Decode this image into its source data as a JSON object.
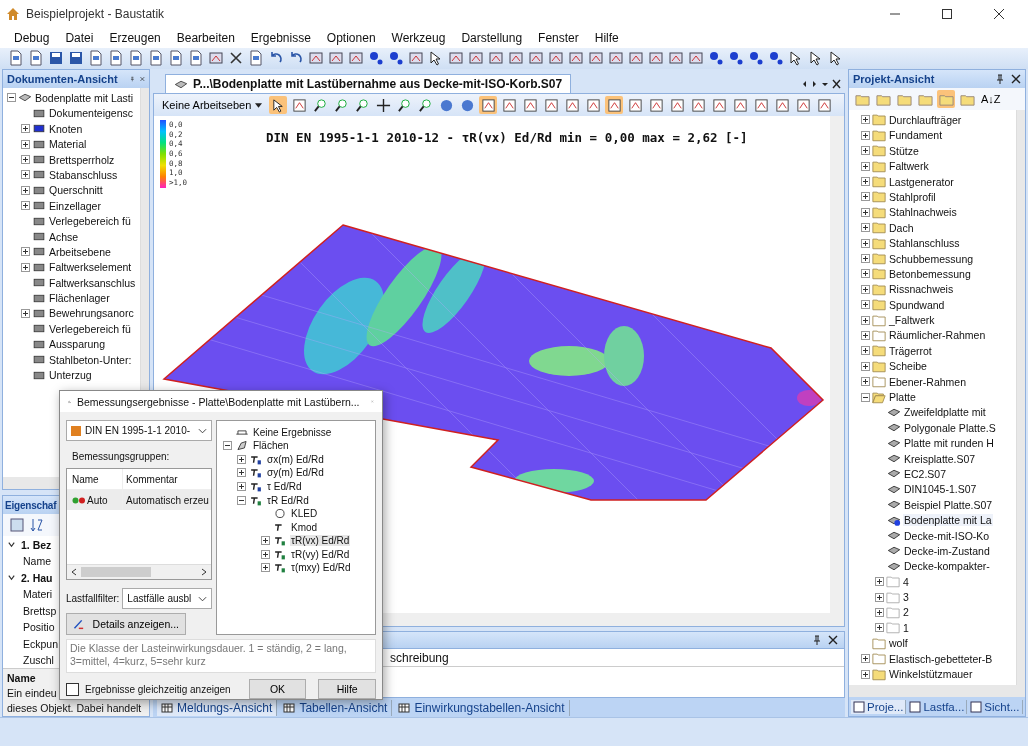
{
  "window": {
    "title": "Beispielprojekt - Baustatik"
  },
  "menu": [
    "Debug",
    "Datei",
    "Erzeugen",
    "Bearbeiten",
    "Ergebnisse",
    "Optionen",
    "Werkzeug",
    "Darstellung",
    "Fenster",
    "Hilfe"
  ],
  "documents_panel": {
    "title": "Dokumenten-Ansicht",
    "root": "Bodenplatte mit Lasti",
    "items": [
      {
        "label": "Dokumenteigensc",
        "kind": "leaf"
      },
      {
        "label": "Knoten",
        "kind": "group"
      },
      {
        "label": "Material",
        "kind": "group"
      },
      {
        "label": "Brettsperrholz",
        "kind": "group"
      },
      {
        "label": "Stabanschluss",
        "kind": "group"
      },
      {
        "label": "Querschnitt",
        "kind": "group"
      },
      {
        "label": "Einzellager",
        "kind": "group"
      },
      {
        "label": "Verlegebereich fü",
        "kind": "leaf"
      },
      {
        "label": "Achse",
        "kind": "leaf"
      },
      {
        "label": "Arbeitsebene",
        "kind": "group"
      },
      {
        "label": "Faltwerkselement",
        "kind": "group"
      },
      {
        "label": "Faltwerksanschlus",
        "kind": "leaf"
      },
      {
        "label": "Flächenlager",
        "kind": "leaf"
      },
      {
        "label": "Bewehrungsanorc",
        "kind": "group"
      },
      {
        "label": "Verlegebereich fü",
        "kind": "leaf"
      },
      {
        "label": "Aussparung",
        "kind": "leaf"
      },
      {
        "label": "Stahlbeton-Unter:",
        "kind": "leaf"
      },
      {
        "label": "Unterzug",
        "kind": "leaf"
      }
    ]
  },
  "properties_panel": {
    "title": "Eigenschaf",
    "rows": [
      {
        "label": "1. Bez",
        "kind": "category"
      },
      {
        "label": "Name",
        "kind": "property"
      },
      {
        "label": "2. Hau",
        "kind": "category"
      },
      {
        "label": "Materi",
        "kind": "property"
      },
      {
        "label": "Brettsp",
        "kind": "property"
      },
      {
        "label": "Positio",
        "kind": "property"
      },
      {
        "label": "Eckpun",
        "kind": "property"
      },
      {
        "label": "Zuschl",
        "kind": "property"
      }
    ],
    "description_title": "Name",
    "description_lines": [
      "Ein eindeu",
      "dieses Objekt. Dabei handelt"
    ]
  },
  "document": {
    "tab": "P...\\Bodenplatte mit Lastübernahme aus Decke-mit-ISO-Korb.S07",
    "work_plane": "Keine Arbeitseben",
    "tools": [
      {
        "selected": true
      },
      {
        "selected": false
      },
      {
        "selected": false
      },
      {
        "selected": false
      },
      {
        "selected": false
      },
      {
        "selected": false
      },
      {
        "selected": false
      },
      {
        "selected": false
      },
      {
        "selected": false
      },
      {
        "selected": false
      },
      {
        "selected": true
      },
      {
        "selected": false
      },
      {
        "selected": false
      },
      {
        "selected": false
      },
      {
        "selected": false
      },
      {
        "selected": false
      },
      {
        "selected": true
      },
      {
        "selected": false
      },
      {
        "selected": false
      },
      {
        "selected": false
      },
      {
        "selected": false
      },
      {
        "selected": false
      },
      {
        "selected": false
      },
      {
        "selected": false
      },
      {
        "selected": false
      },
      {
        "selected": false
      },
      {
        "selected": false
      }
    ],
    "heading": "DIN EN 1995-1-1 2010-12 - τR(vx) Ed/Rd min = 0,00 max = 2,62 [-]",
    "legend": [
      "0,0",
      "0,2",
      "0,4",
      "0,6",
      "0,8",
      "1,0",
      ">1,0"
    ]
  },
  "bottom_panel": {
    "column": "schreibung",
    "tabs": [
      {
        "label": "Meldungs-Ansicht",
        "selected": true
      },
      {
        "label": "Tabellen-Ansicht",
        "selected": false
      },
      {
        "label": "Einwirkungstabellen-Ansicht",
        "selected": false
      }
    ]
  },
  "project_panel": {
    "title": "Projekt-Ansicht",
    "tools": [
      {
        "selected": false
      },
      {
        "selected": false
      },
      {
        "selected": false
      },
      {
        "selected": false
      },
      {
        "selected": true
      },
      {
        "selected": false
      }
    ],
    "sort": "A↓Z",
    "items": [
      {
        "label": "Durchlaufträger",
        "color": "#f5dc7a",
        "expanded": false
      },
      {
        "label": "Fundament",
        "color": "#f5dc7a",
        "expanded": false
      },
      {
        "label": "Stütze",
        "color": "#f5dc7a",
        "expanded": false
      },
      {
        "label": "Faltwerk",
        "color": "#f5dc7a",
        "expanded": false
      },
      {
        "label": "Lastgenerator",
        "color": "#f5dc7a",
        "expanded": false
      },
      {
        "label": "Stahlprofil",
        "color": "#f5dc7a",
        "expanded": false
      },
      {
        "label": "Stahlnachweis",
        "color": "#f5dc7a",
        "expanded": false
      },
      {
        "label": "Dach",
        "color": "#f5dc7a",
        "expanded": false
      },
      {
        "label": "Stahlanschluss",
        "color": "#f5dc7a",
        "expanded": false
      },
      {
        "label": "Schubbemessung",
        "color": "#f5dc7a",
        "expanded": false
      },
      {
        "label": "Betonbemessung",
        "color": "#f5dc7a",
        "expanded": false
      },
      {
        "label": "Rissnachweis",
        "color": "#f5dc7a",
        "expanded": false
      },
      {
        "label": "Spundwand",
        "color": "#f5dc7a",
        "expanded": false
      },
      {
        "label": "_Faltwerk",
        "color": "#ffffff",
        "expanded": false
      },
      {
        "label": "Räumlicher-Rahmen",
        "color": "#ffffff",
        "expanded": false
      },
      {
        "label": "Trägerrot",
        "color": "#f5dc7a",
        "expanded": false
      },
      {
        "label": "Scheibe",
        "color": "#f5dc7a",
        "expanded": false
      },
      {
        "label": "Ebener-Rahmen",
        "color": "#ffffff",
        "expanded": false
      },
      {
        "label": "Platte",
        "color": "#f5dc7a",
        "expanded": true,
        "children": [
          {
            "label": "Zweifeldplatte mit",
            "kind": "file",
            "selected": false
          },
          {
            "label": "Polygonale Platte.S",
            "kind": "file",
            "selected": false
          },
          {
            "label": "Platte mit runden H",
            "kind": "file",
            "selected": false
          },
          {
            "label": "Kreisplatte.S07",
            "kind": "file",
            "selected": false
          },
          {
            "label": "EC2.S07",
            "kind": "file",
            "selected": false
          },
          {
            "label": "DIN1045-1.S07",
            "kind": "file",
            "selected": false
          },
          {
            "label": "Beispiel Platte.S07",
            "kind": "file",
            "selected": false
          },
          {
            "label": "Bodenplatte mit La",
            "kind": "file",
            "selected": true
          },
          {
            "label": "Decke-mit-ISO-Ko",
            "kind": "file",
            "selected": false
          },
          {
            "label": "Decke-im-Zustand",
            "kind": "file",
            "selected": false
          },
          {
            "label": "Decke-kompakter-",
            "kind": "file",
            "selected": false
          },
          {
            "label": "4",
            "kind": "folder",
            "selected": false
          },
          {
            "label": "3",
            "kind": "folder",
            "selected": false
          },
          {
            "label": "2",
            "kind": "folder",
            "selected": false
          },
          {
            "label": "1",
            "kind": "folder",
            "selected": false
          }
        ]
      },
      {
        "label": "wolf",
        "color": "#ffffff"
      },
      {
        "label": "Elastisch-gebetteter-B",
        "color": "#ffffff",
        "expanded": false
      },
      {
        "label": "Winkelstützmauer",
        "color": "#f5dc7a",
        "expanded": false
      }
    ],
    "tabs": [
      {
        "label": "Proje...",
        "selected": true
      },
      {
        "label": "Lastfa...",
        "selected": false
      },
      {
        "label": "Sicht...",
        "selected": false
      }
    ]
  },
  "dialog": {
    "title": "Bemessungsergebnisse - Platte\\Bodenplatte mit Lastübern...",
    "standard": "DIN EN 1995-1-1 2010-",
    "groups_label": "Bemessungsgruppen:",
    "columns": [
      "Name",
      "Kommentar"
    ],
    "rows": [
      {
        "name": "Auto",
        "comment": "Automatisch erzeu",
        "selected": true
      }
    ],
    "filter_label": "Lastfallfilter:",
    "filter": "Lastfälle ausbl",
    "details_button": "Details anzeigen...",
    "tree": [
      {
        "label": "Keine Ergebnisse",
        "selected": false
      },
      {
        "label": "Flächen",
        "expanded": true,
        "selected": false,
        "children": [
          {
            "label": "σx(m) Ed/Rd",
            "expanded": false,
            "selected": false
          },
          {
            "label": "σy(m) Ed/Rd",
            "expanded": false,
            "selected": false
          },
          {
            "label": "τ Ed/Rd",
            "expanded": false,
            "selected": false
          },
          {
            "label": "τR Ed/Rd",
            "expanded": true,
            "selected": false,
            "children": [
              {
                "label": "KLED",
                "selected": false
              },
              {
                "label": "Kmod",
                "selected": false
              },
              {
                "label": "τR(vx) Ed/Rd",
                "expanded": false,
                "selected": true
              },
              {
                "label": "τR(vy) Ed/Rd",
                "expanded": false,
                "selected": false
              },
              {
                "label": "τ(mxy) Ed/Rd",
                "expanded": false,
                "selected": false
              }
            ]
          }
        ]
      }
    ],
    "description": "Die Klasse der Lasteinwirkungsdauer. 1 = ständig, 2 = lang, 3=mittel, 4=kurz, 5=sehr kurz",
    "simultaneous": {
      "label": "Ergebnisse gleichzeitig anzeigen",
      "checked": false
    },
    "buttons": [
      "OK",
      "Hilfe"
    ]
  }
}
